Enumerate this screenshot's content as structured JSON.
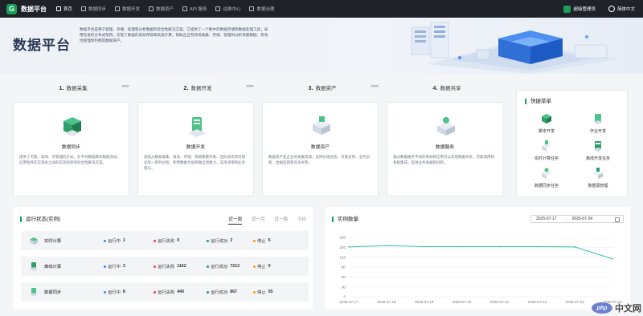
{
  "nav": {
    "brand": "数据平台",
    "logo_glyph": "G",
    "items": [
      {
        "label": "首页",
        "active": true
      },
      {
        "label": "数据同步",
        "active": false
      },
      {
        "label": "数据开发",
        "active": false
      },
      {
        "label": "数据资产",
        "active": false
      },
      {
        "label": "API 服务",
        "active": false
      },
      {
        "label": "运维中心",
        "active": false
      },
      {
        "label": "数据治理",
        "active": false
      }
    ],
    "user": "超级管理员",
    "language": "简体中文"
  },
  "banner": {
    "title": "数据平台",
    "description": "数据平台是用于管理、存储、处理和分析数据的综合性解决方案。它提供了一个集中的数据存储和数据处理工具，采用先进的分布式架构，实现了数据的高效存取和高速计算，帮助企业有效地收集、存储、管理和分析海量数据，有效地管理和利用其数据资产。"
  },
  "steps": [
    {
      "num": "1.",
      "label": "数据采集"
    },
    {
      "num": "2.",
      "label": "数据开发"
    },
    {
      "num": "3.",
      "label": "数据资产"
    },
    {
      "num": "4.",
      "label": "数据共享"
    }
  ],
  "step_arrows": "›››››››››",
  "cards": [
    {
      "title": "数据同步",
      "desc": "提供了可靠、高效、可管理的方式，在不同数据库间数据流动，应用程序在实现各之间的实际同步的综合性解决方案。"
    },
    {
      "title": "数据开发",
      "desc": "涵盖从数据收集、清洗、存储、预测建模开发、团队协作到可视化等一系列过程，利用数据为组织做出洞察力，支持决策和业务增长。"
    },
    {
      "title": "数据资产",
      "desc": "数据资产是企业的关键资源，支持价值创造、决策支持、业务创新、合规监管和竞争优势。"
    },
    {
      "title": "数据服务",
      "desc": "通过数据服务不同的系统和应用可以实现数据共享，可能调用和系统集成，促进业务发展和创新。"
    }
  ],
  "quick_menu": {
    "title": "快捷菜单",
    "items": [
      "脚本开发",
      "作业开发",
      "实时计算任务",
      "离线开发任务",
      "数据同步任务",
      "数据源管理"
    ]
  },
  "run_status": {
    "title": "运行状态(实例)",
    "ranges": [
      {
        "label": "近一周",
        "active": true
      },
      {
        "label": "近一月",
        "active": false
      },
      {
        "label": "近一周",
        "active": false
      },
      {
        "label": "今日",
        "active": false
      }
    ],
    "rows": [
      {
        "name": "实时计算",
        "running": "1",
        "failed": "0",
        "success": "2",
        "stopped": "5"
      },
      {
        "name": "离线计算",
        "running": "3",
        "failed": "1162",
        "success": "7213",
        "stopped": "0"
      },
      {
        "name": "数据同步",
        "running": "8",
        "failed": "440",
        "success": "867",
        "stopped": "55"
      }
    ],
    "labels": {
      "running": "运行中",
      "failed": "运行失败",
      "success": "运行成功",
      "stopped": "停止"
    },
    "colors": {
      "running": "#3b82f6",
      "failed": "#ef4444",
      "success": "#18a058",
      "stopped": "#f59e0b"
    }
  },
  "instances": {
    "title": "实例数量",
    "date_start": "2025-07-17",
    "date_sep": "→",
    "date_end": "2025-07-24"
  },
  "chart_data": {
    "type": "line",
    "title": "实例数量",
    "x": [
      "2025-07-17",
      "2025-07-18",
      "2025-07-19",
      "2025-07-20",
      "2025-07-21",
      "2025-07-22",
      "2025-07-23",
      "2025-07-24"
    ],
    "series": [
      {
        "values": [
          151,
          155,
          152,
          152,
          152,
          152,
          151,
          115
        ]
      }
    ],
    "ylim": [
      0,
      180
    ],
    "yticks": [
      0,
      30,
      60,
      90,
      120,
      150,
      180
    ],
    "grid": true,
    "color": "#3bbfae"
  },
  "watermark": {
    "badge": "php",
    "text": "中文网"
  }
}
